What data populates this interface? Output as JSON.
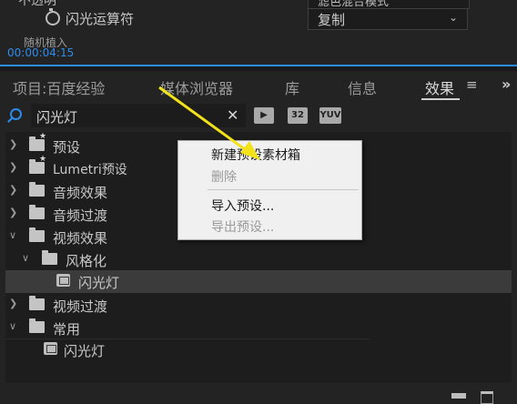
{
  "effect_controls": {
    "row1_label": "不透明",
    "row1_value": "滤色混合模式",
    "row2_label": "闪光运算符",
    "row2_value": "复制",
    "row3_label": "随机植入",
    "timecode": "00:00:04:15"
  },
  "tabs": [
    {
      "label": "项目:百度经验"
    },
    {
      "label": "媒体浏览器"
    },
    {
      "label": "库"
    },
    {
      "label": "信息"
    },
    {
      "label": "效果"
    }
  ],
  "tab_menu_glyph": "≡",
  "overflow_glyph": "»",
  "search": {
    "value": "闪光灯",
    "clear_glyph": "✕"
  },
  "filter_icons": [
    {
      "name": "accelerated-effects-icon",
      "text": "▶"
    },
    {
      "name": "32bit-color-icon",
      "text": "32"
    },
    {
      "name": "yuv-effects-icon",
      "text": "YUV"
    }
  ],
  "tree": [
    {
      "label": "预设",
      "expanded": false
    },
    {
      "label": "Lumetri预设",
      "expanded": false
    },
    {
      "label": "音频效果",
      "expanded": false
    },
    {
      "label": "音频过渡",
      "expanded": false
    },
    {
      "label": "视频效果",
      "expanded": true
    },
    {
      "label": "风格化",
      "expanded": true
    },
    {
      "label": "闪光灯",
      "selected": true
    },
    {
      "label": "视频过渡",
      "expanded": false
    },
    {
      "label": "常用",
      "expanded": true
    },
    {
      "label": "闪光灯"
    }
  ],
  "context_menu": {
    "items": [
      {
        "label": "新建预设素材箱",
        "enabled": true
      },
      {
        "label": "删除",
        "enabled": false
      },
      {
        "label": "导入预设...",
        "enabled": true
      },
      {
        "label": "导出预设...",
        "enabled": false
      }
    ]
  },
  "colors": {
    "accent": "#2d8ceb",
    "annotation_arrow": "#f2e21a",
    "panel_bg": "#232323",
    "menu_bg": "#f0f0f0"
  }
}
